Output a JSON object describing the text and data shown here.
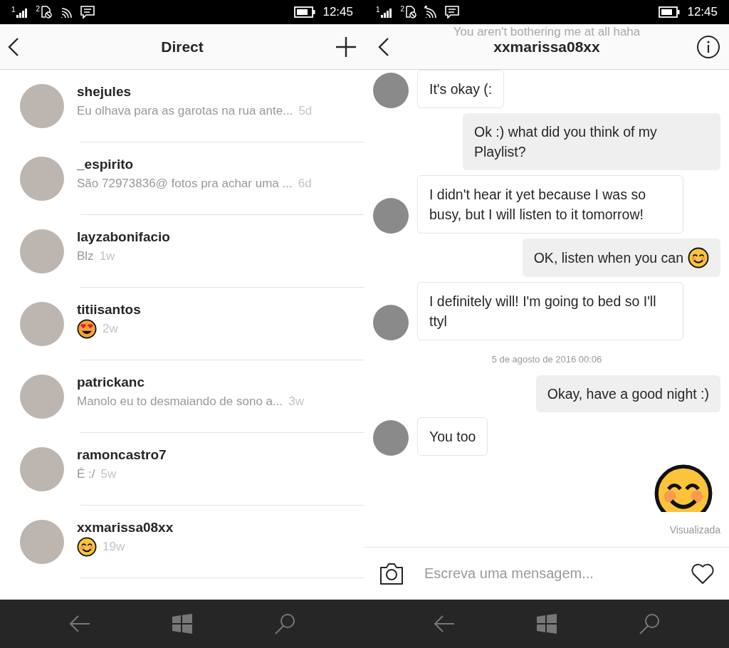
{
  "status_bars": [
    {
      "sim_labels": [
        "1",
        "2"
      ],
      "wifi_arrow": false,
      "time": "12:45"
    },
    {
      "sim_labels": [
        "1",
        "2"
      ],
      "wifi_arrow": true,
      "time": "12:45"
    }
  ],
  "inbox": {
    "title": "Direct",
    "conversations": [
      {
        "name": "shejules",
        "kind": "text",
        "preview": "Eu olhava para as garotas na rua ante...",
        "age": "5d"
      },
      {
        "name": "_espirito",
        "kind": "text",
        "preview": "São 72973836@ fotos pra achar uma ...",
        "age": "6d"
      },
      {
        "name": "layzabonifacio",
        "kind": "text",
        "preview": "Blz",
        "age": "1w"
      },
      {
        "name": "titiisantos",
        "kind": "heart-eyes",
        "age": "2w"
      },
      {
        "name": "patrickanc",
        "kind": "text",
        "preview": "Manolo eu to desmaiando de sono a...",
        "age": "3w"
      },
      {
        "name": "ramoncastro7",
        "kind": "text",
        "preview": "É :/",
        "age": "5w"
      },
      {
        "name": "xxmarissa08xx",
        "kind": "smile",
        "age": "19w"
      }
    ]
  },
  "chat": {
    "title": "xxmarissa08xx",
    "faded_text": "You aren't bothering me at all haha",
    "messages": [
      {
        "kind": "incoming",
        "text": "It's okay (:"
      },
      {
        "kind": "outgoing",
        "text": "Ok :) what did you think of my Playlist?"
      },
      {
        "kind": "incoming",
        "text": "I didn't hear it yet because I was so busy, but I will listen to it tomorrow!"
      },
      {
        "kind": "outgoing-smile",
        "text": "OK, listen when you can"
      },
      {
        "kind": "incoming",
        "text": "I definitely will! I'm going to bed so I'll ttyl"
      },
      {
        "kind": "date",
        "text": "5 de agosto de 2016 00:06"
      },
      {
        "kind": "outgoing",
        "text": "Okay, have a good night :)"
      },
      {
        "kind": "incoming",
        "text": "You too"
      },
      {
        "kind": "big-smile"
      }
    ],
    "seen": "Visualizada",
    "composer": {
      "placeholder": "Escreva uma mensagem..."
    }
  }
}
